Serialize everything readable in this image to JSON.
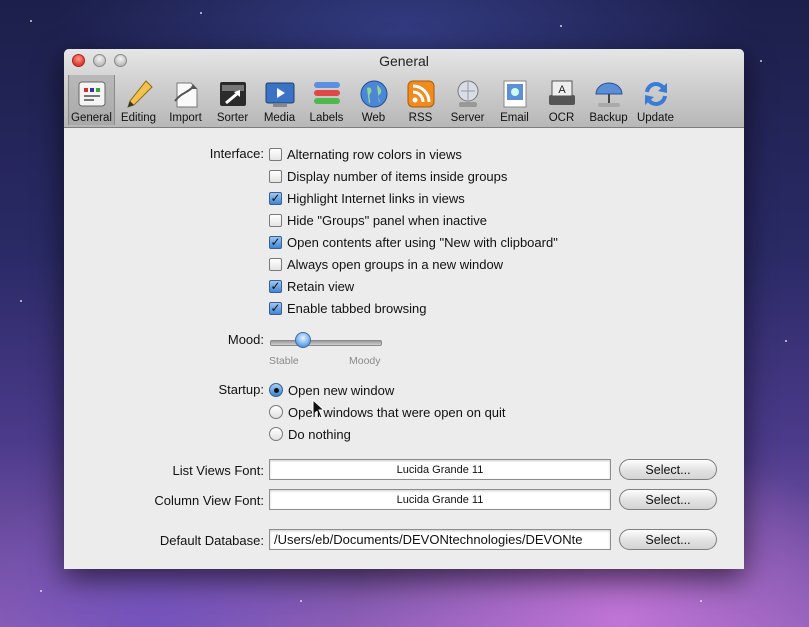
{
  "window": {
    "title": "General"
  },
  "toolbar": [
    {
      "label": "General",
      "icon": "general-prefs-icon"
    },
    {
      "label": "Editing",
      "icon": "pencil-icon"
    },
    {
      "label": "Import",
      "icon": "import-icon"
    },
    {
      "label": "Sorter",
      "icon": "sorter-icon"
    },
    {
      "label": "Media",
      "icon": "media-icon"
    },
    {
      "label": "Labels",
      "icon": "labels-icon"
    },
    {
      "label": "Web",
      "icon": "globe-icon"
    },
    {
      "label": "RSS",
      "icon": "rss-icon"
    },
    {
      "label": "Server",
      "icon": "server-icon"
    },
    {
      "label": "Email",
      "icon": "email-icon"
    },
    {
      "label": "OCR",
      "icon": "scanner-icon"
    },
    {
      "label": "Backup",
      "icon": "umbrella-icon"
    },
    {
      "label": "Update",
      "icon": "update-arrows-icon"
    }
  ],
  "interface": {
    "label": "Interface:",
    "options": [
      {
        "label": "Alternating row colors in views",
        "checked": false
      },
      {
        "label": "Display number of items inside groups",
        "checked": false
      },
      {
        "label": "Highlight Internet links in views",
        "checked": true
      },
      {
        "label": "Hide \"Groups\" panel when inactive",
        "checked": false
      },
      {
        "label": "Open contents after using \"New with clipboard\"",
        "checked": true
      },
      {
        "label": "Always open groups in a new window",
        "checked": false
      },
      {
        "label": "Retain view",
        "checked": true
      },
      {
        "label": "Enable tabbed browsing",
        "checked": true
      }
    ]
  },
  "mood": {
    "label": "Mood:",
    "min_label": "Stable",
    "max_label": "Moody",
    "value": 0.3
  },
  "startup": {
    "label": "Startup:",
    "options": [
      {
        "label": "Open new window",
        "selected": true
      },
      {
        "label": "Open windows that were open on quit",
        "selected": false
      },
      {
        "label": "Do nothing",
        "selected": false
      }
    ]
  },
  "fonts": {
    "list_label": "List Views Font:",
    "list_value": "Lucida Grande 11",
    "column_label": "Column View Font:",
    "column_value": "Lucida Grande 11"
  },
  "database": {
    "label": "Default Database:",
    "value": "/Users/eb/Documents/DEVONtechnologies/DEVONte"
  },
  "select_button": "Select..."
}
